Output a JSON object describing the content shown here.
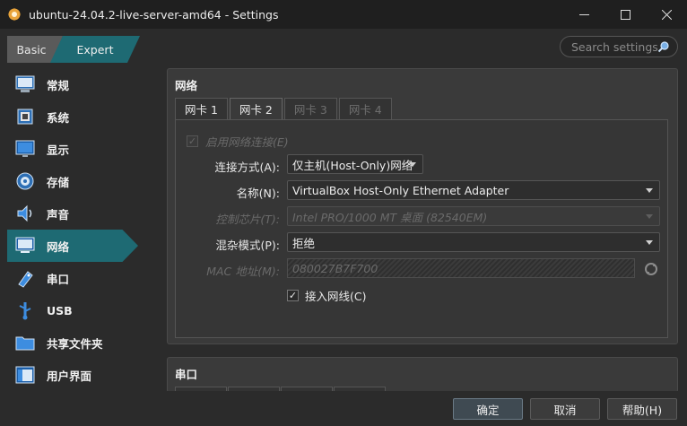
{
  "window": {
    "title": "ubuntu-24.04.2-live-server-amd64 - Settings"
  },
  "mode": {
    "basic": "Basic",
    "expert": "Expert"
  },
  "search": {
    "placeholder": "Search settings"
  },
  "sidebar": {
    "items": [
      {
        "label": "常规",
        "icon": "general-icon"
      },
      {
        "label": "系统",
        "icon": "system-icon"
      },
      {
        "label": "显示",
        "icon": "display-icon"
      },
      {
        "label": "存储",
        "icon": "storage-icon"
      },
      {
        "label": "声音",
        "icon": "audio-icon"
      },
      {
        "label": "网络",
        "icon": "network-icon",
        "active": true
      },
      {
        "label": "串口",
        "icon": "serial-icon"
      },
      {
        "label": "USB",
        "icon": "usb-icon"
      },
      {
        "label": "共享文件夹",
        "icon": "shared-folder-icon"
      },
      {
        "label": "用户界面",
        "icon": "user-interface-icon"
      }
    ]
  },
  "network": {
    "title": "网络",
    "tabs": [
      {
        "label": "网卡 1",
        "state": "normal"
      },
      {
        "label": "网卡 2",
        "state": "active"
      },
      {
        "label": "网卡 3",
        "state": "disabled"
      },
      {
        "label": "网卡 4",
        "state": "disabled"
      }
    ],
    "enable_label": "启用网络连接(E)",
    "attached_label": "连接方式(A):",
    "attached_value": "仅主机(Host-Only)网络",
    "name_label": "名称(N):",
    "name_value": "VirtualBox Host-Only Ethernet Adapter",
    "adapter_type_label": "控制芯片(T):",
    "adapter_type_value": "Intel PRO/1000 MT 桌面 (82540EM)",
    "promiscuous_label": "混杂模式(P):",
    "promiscuous_value": "拒绝",
    "mac_label": "MAC 地址(M):",
    "mac_value": "080027B7F700",
    "cable_label": "接入网线(C)"
  },
  "serial": {
    "title": "串口"
  },
  "footer": {
    "ok": "确定",
    "cancel": "取消",
    "help": "帮助(H)"
  },
  "colors": {
    "accent": "#1e6a73",
    "background": "#2b2b2b",
    "panel": "#3a3a3a"
  }
}
